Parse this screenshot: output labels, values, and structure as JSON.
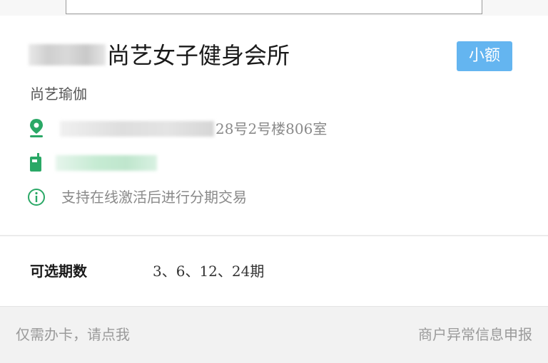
{
  "merchant": {
    "name": "尚艺女子健身会所",
    "category": "尚艺瑜伽",
    "badge": "小额",
    "address_suffix": "28号2号楼806室",
    "notice": "支持在线激活后进行分期交易"
  },
  "installments": {
    "label": "可选期数",
    "value": "3、6、12、24期"
  },
  "footer": {
    "left_link": "仅需办卡，请点我",
    "right_link": "商户异常信息申报"
  },
  "icons": {
    "location": "location-pin-icon",
    "phone": "phone-icon",
    "info": "info-circle-icon"
  },
  "colors": {
    "accent_green": "#2aa866",
    "badge_blue": "#64b5f0"
  }
}
